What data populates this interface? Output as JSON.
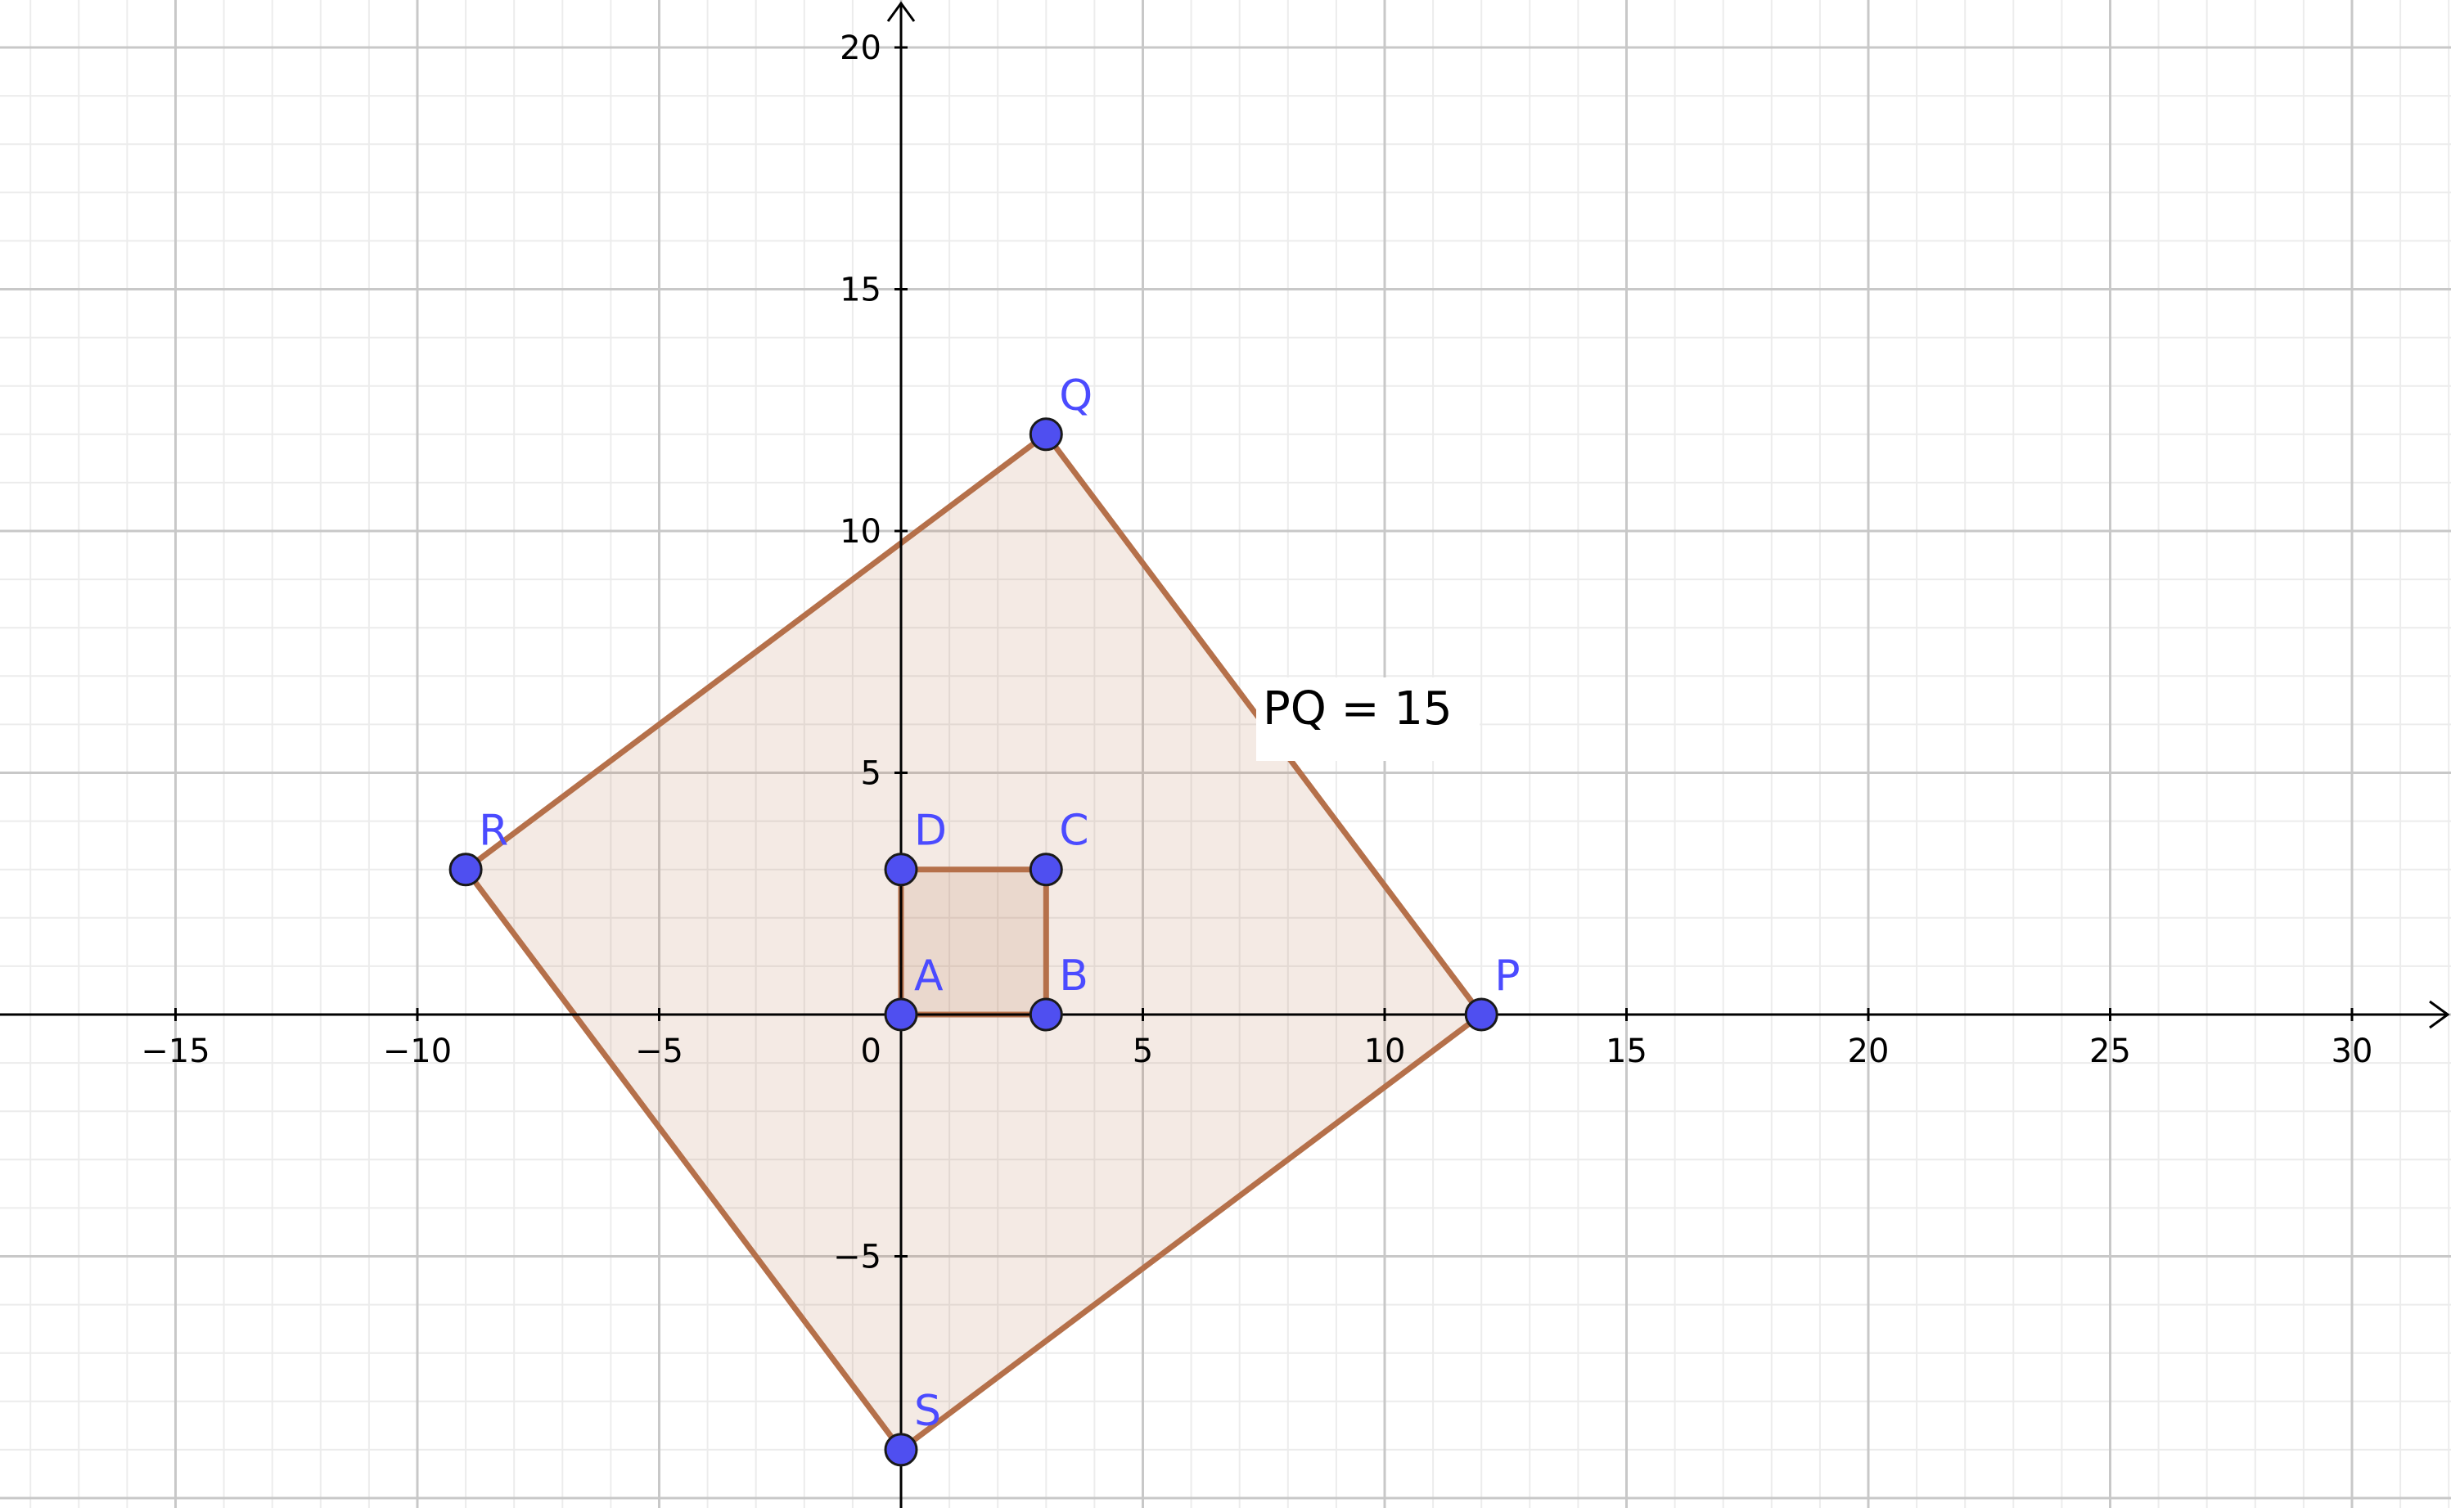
{
  "graph": {
    "x_ticks": [
      {
        "value": -15,
        "label": "−15"
      },
      {
        "value": -10,
        "label": "−10"
      },
      {
        "value": -5,
        "label": "−5"
      },
      {
        "value": 5,
        "label": "5"
      },
      {
        "value": 10,
        "label": "10"
      },
      {
        "value": 15,
        "label": "15"
      },
      {
        "value": 20,
        "label": "20"
      },
      {
        "value": 25,
        "label": "25"
      },
      {
        "value": 30,
        "label": "30"
      }
    ],
    "y_ticks": [
      {
        "value": 5,
        "label": "5"
      },
      {
        "value": 10,
        "label": "10"
      },
      {
        "value": 15,
        "label": "15"
      },
      {
        "value": 20,
        "label": "20"
      },
      {
        "value": -5,
        "label": "−5"
      }
    ],
    "origin_label": "0",
    "x_range": [
      -18.6,
      32.1
    ],
    "y_range": [
      -10.2,
      21.0
    ],
    "points": [
      {
        "name": "A",
        "label": "A",
        "x": 0,
        "y": 0
      },
      {
        "name": "B",
        "label": "B",
        "x": 3,
        "y": 0
      },
      {
        "name": "C",
        "label": "C",
        "x": 3,
        "y": 3
      },
      {
        "name": "D",
        "label": "D",
        "x": 0,
        "y": 3
      },
      {
        "name": "P",
        "label": "P",
        "x": 12,
        "y": 0
      },
      {
        "name": "Q",
        "label": "Q",
        "x": 3,
        "y": 12
      },
      {
        "name": "R",
        "label": "R",
        "x": -9,
        "y": 3
      },
      {
        "name": "S",
        "label": "S",
        "x": 0,
        "y": -9
      }
    ],
    "polygons": [
      {
        "name": "outer-square",
        "vertices": [
          "P",
          "Q",
          "R",
          "S"
        ]
      },
      {
        "name": "inner-square",
        "vertices": [
          "A",
          "B",
          "C",
          "D"
        ]
      }
    ],
    "measurement": {
      "text": "PQ = 15"
    },
    "colors": {
      "polygon_stroke": "#b5704a",
      "polygon_fill": "#b5704a",
      "point_fill": "#4f4ff0",
      "point_stroke": "#1a1a1a",
      "point_label": "#4b4bff",
      "major_grid": "#c8c8c8",
      "minor_grid": "#ececec",
      "axis": "#000000"
    }
  }
}
